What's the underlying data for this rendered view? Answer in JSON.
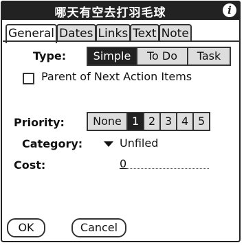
{
  "window": {
    "title": "哪天有空去打羽毛球",
    "info_glyph": "i"
  },
  "tabs": [
    "General",
    "Dates",
    "Links",
    "Text",
    "Note"
  ],
  "type": {
    "label": "Type:",
    "options": [
      "Simple",
      "To Do",
      "Task"
    ],
    "selected": "Simple"
  },
  "parent_checkbox": {
    "label": "Parent of Next Action Items",
    "checked": false
  },
  "priority": {
    "label": "Priority:",
    "options": [
      "None",
      "1",
      "2",
      "3",
      "4",
      "5"
    ],
    "selected": "1"
  },
  "category": {
    "label": "Category:",
    "value": "Unfiled"
  },
  "cost": {
    "label": "Cost:",
    "value": "0"
  },
  "buttons": {
    "ok": "OK",
    "cancel": "Cancel"
  }
}
